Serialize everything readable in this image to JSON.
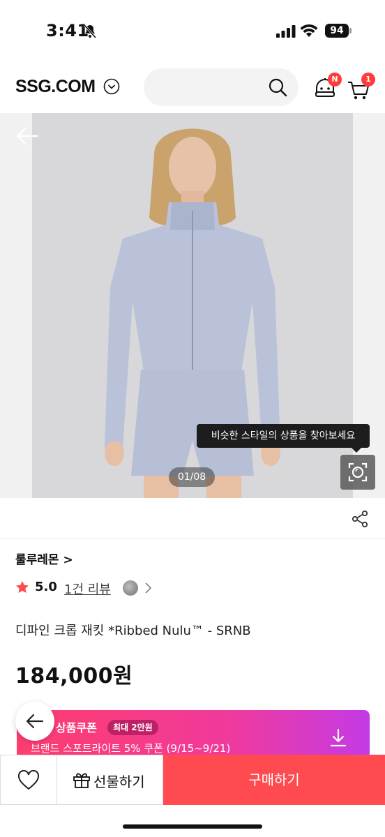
{
  "status_bar": {
    "time": "3:41",
    "battery": "94"
  },
  "header": {
    "logo": "SSG.COM",
    "notification_badge": "N",
    "cart_badge": "1"
  },
  "gallery": {
    "tooltip": "비슷한 스타일의 상품을 찾아보세요",
    "page_indicator": "01/08"
  },
  "product": {
    "brand": "룰루레몬 >",
    "rating": "5.0",
    "review_count": "1건 리뷰",
    "name": "디파인 크롭 재킷 *Ribbed Nulu™ - SRNB",
    "price": "184,000원"
  },
  "coupon": {
    "title": "상품쿠폰",
    "chip": "최대 2만원",
    "description": "브랜드 스포트라이트 5% 쿠폰 (9/15~9/21)"
  },
  "bottom_bar": {
    "gift_label": "선물하기",
    "buy_label": "구매하기"
  },
  "colors": {
    "accent": "#ff4a4f",
    "badge": "#ff3c3c",
    "star": "#ff4a4f"
  }
}
